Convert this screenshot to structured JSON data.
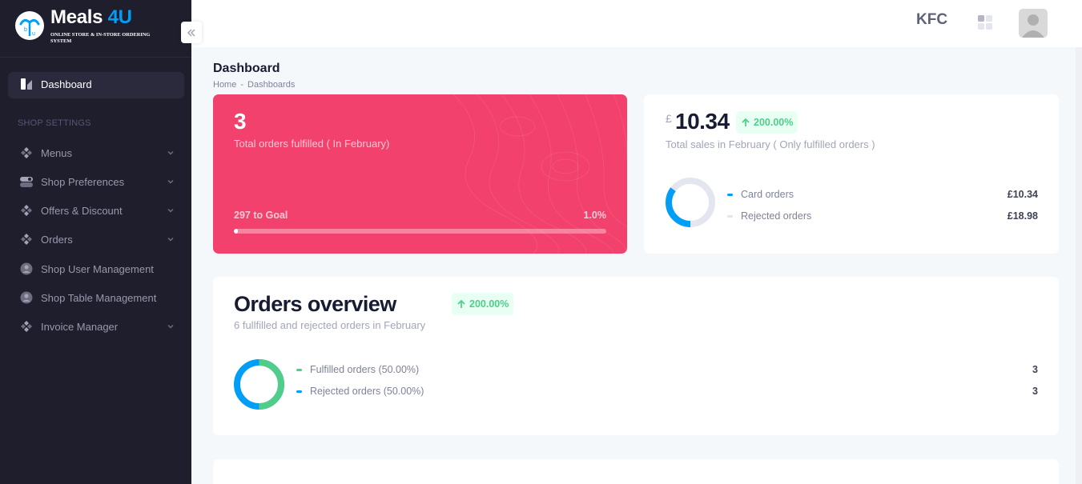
{
  "brand": {
    "name_main": "Meals",
    "name_accent": "4U",
    "tagline": "ONLINE STORE & IN-STORE ORDERING SYSTEM"
  },
  "sidebar": {
    "active_item": {
      "label": "Dashboard",
      "icon": "dashboard-icon"
    },
    "section_title": "SHOP SETTINGS",
    "items": [
      {
        "label": "Menus",
        "icon": "diamond-cluster-icon",
        "has_submenu": true
      },
      {
        "label": "Shop Preferences",
        "icon": "toggle-icon",
        "has_submenu": true
      },
      {
        "label": "Offers & Discount",
        "icon": "diamond-cluster-icon",
        "has_submenu": true
      },
      {
        "label": "Orders",
        "icon": "diamond-cluster-icon",
        "has_submenu": true
      },
      {
        "label": "Shop User Management",
        "icon": "user-circle-icon",
        "has_submenu": false
      },
      {
        "label": "Shop Table Management",
        "icon": "user-circle-icon",
        "has_submenu": false
      },
      {
        "label": "Invoice Manager",
        "icon": "diamond-cluster-icon",
        "has_submenu": true
      }
    ]
  },
  "header": {
    "shop_name": "KFC"
  },
  "toolbar": {
    "title": "Dashboard",
    "breadcrumb": [
      "Home",
      "-",
      "Dashboards"
    ]
  },
  "orders_card": {
    "value": "3",
    "subtitle": "Total orders fulfilled ( In February)",
    "goal_text": "297 to Goal",
    "goal_percent_text": "1.0%",
    "progress_fraction": 0.01,
    "color": "#f1416c"
  },
  "sales_card": {
    "currency": "£",
    "value": "10.34",
    "badge": "200.00%",
    "subtitle": "Total sales in February ( Only fulfilled orders )",
    "donut_fraction": 0.353,
    "legend": [
      {
        "label": "Card orders",
        "value": "£10.34",
        "color": "#009ef7"
      },
      {
        "label": "Rejected orders",
        "value": "£18.98",
        "color": "#e4e6ef"
      }
    ]
  },
  "overview_card": {
    "title": "Orders overview",
    "badge": "200.00%",
    "subtitle": "6 fullfilled and rejected orders in February",
    "donut_fraction": 0.5,
    "legend": [
      {
        "label": "Fulfilled orders (50.00%)",
        "value": "3",
        "color": "#50cd89"
      },
      {
        "label": "Rejected orders (50.00%)",
        "value": "3",
        "color": "#009ef7"
      }
    ]
  },
  "colors": {
    "sidebar_bg": "#1e1e2d",
    "primary": "#009ef7",
    "success": "#50cd89",
    "danger": "#f1416c",
    "page_bg": "#f5f8fa"
  }
}
